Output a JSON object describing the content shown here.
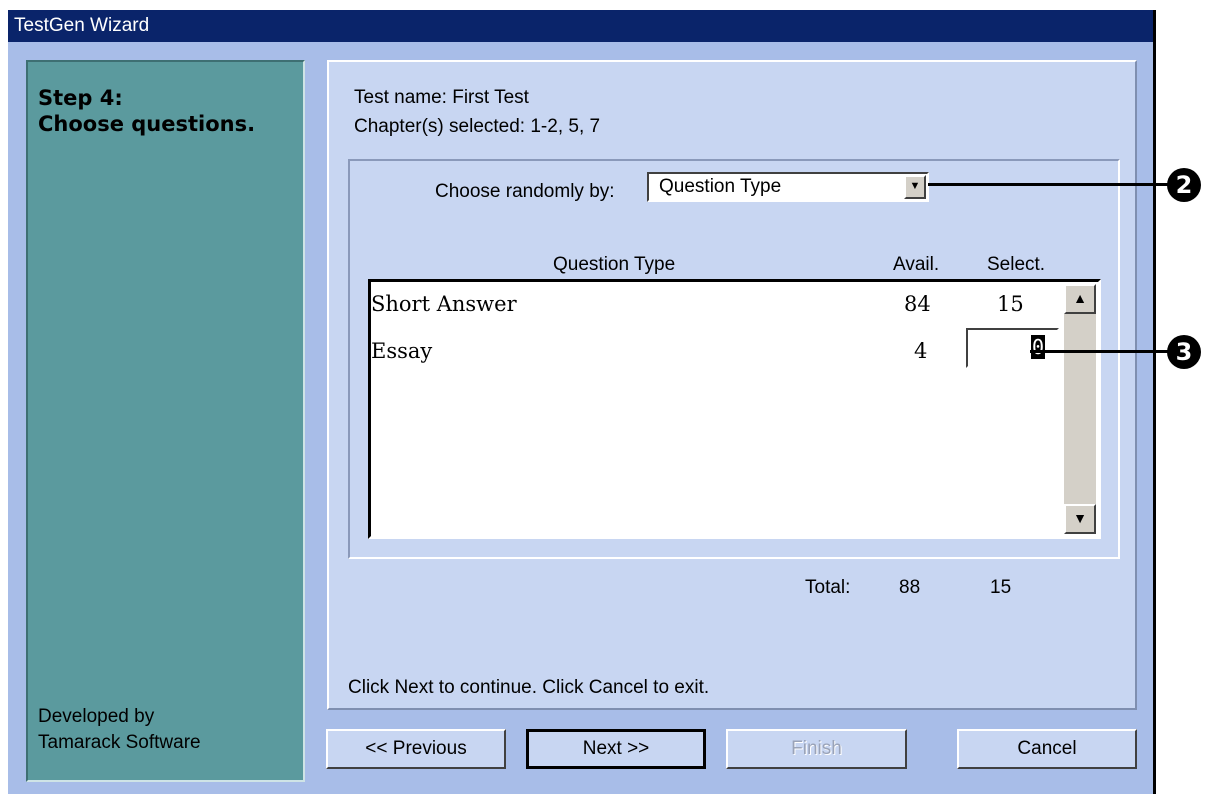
{
  "window": {
    "title": "TestGen Wizard"
  },
  "sidebar": {
    "step": "Step 4:",
    "instruction": "Choose questions.",
    "developer_line1": "Developed by",
    "developer_line2": "Tamarack Software"
  },
  "info": {
    "test_name": "Test name: First Test",
    "chapters": "Chapter(s) selected: 1-2, 5, 7"
  },
  "random_by": {
    "label": "Choose randomly by:",
    "selected": "Question Type"
  },
  "table": {
    "headers": {
      "type": "Question Type",
      "avail": "Avail.",
      "select": "Select."
    },
    "rows": [
      {
        "type": "Short Answer",
        "avail": "84",
        "select": "15"
      },
      {
        "type": "Essay",
        "avail": "4",
        "select": "0"
      }
    ],
    "total_label": "Total:",
    "total_avail": "88",
    "total_select": "15"
  },
  "footer_hint": "Click Next to continue. Click Cancel to exit.",
  "buttons": {
    "previous": "<< Previous",
    "next": "Next >>",
    "finish": "Finish",
    "cancel": "Cancel"
  },
  "callouts": {
    "first": "2",
    "second": "3"
  },
  "icons": {
    "combo_arrow": "chevron-down-icon",
    "scroll_up": "arrow-up-icon",
    "scroll_down": "arrow-down-icon"
  }
}
